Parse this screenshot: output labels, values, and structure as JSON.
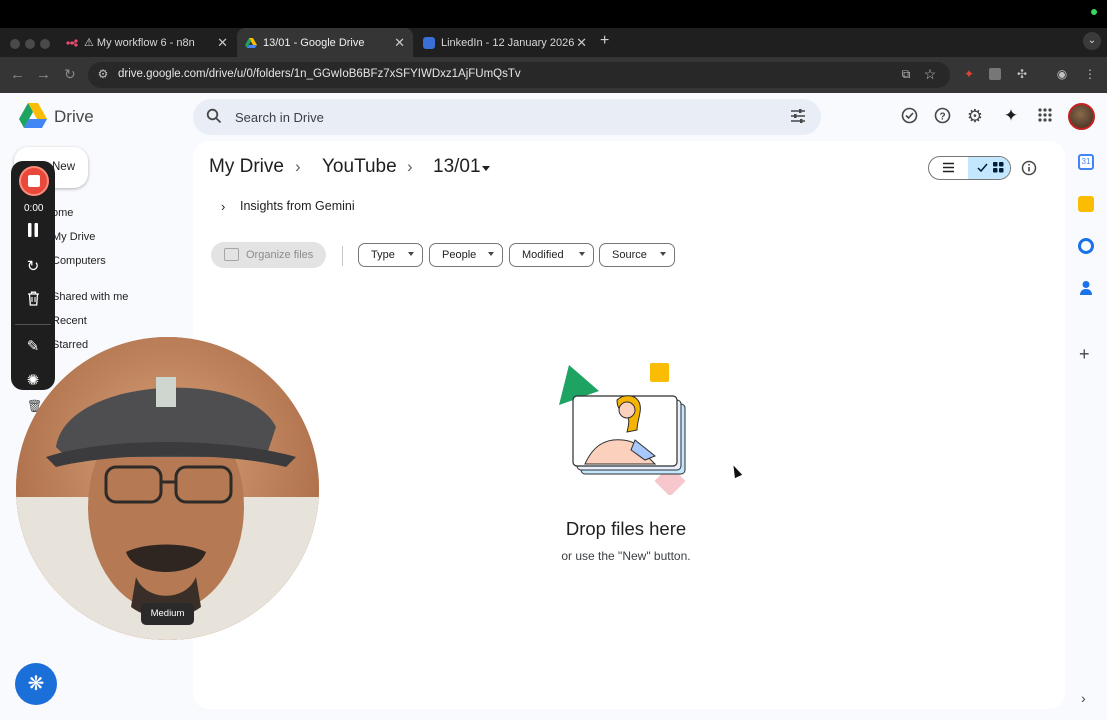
{
  "browser": {
    "tabs": [
      {
        "title": "⚠ My workflow 6 - n8n",
        "active": false
      },
      {
        "title": "13/01 - Google Drive",
        "active": true
      },
      {
        "title": "LinkedIn - 12 January 2026",
        "active": false
      }
    ],
    "new_tab_symbol": "+",
    "close_symbol": "✕",
    "url": "drive.google.com/drive/u/0/folders/1n_GGwIoB6BFz7xSFYIWDxz1AjFUmQsTv"
  },
  "drive": {
    "app_name": "Drive",
    "search_placeholder": "Search in Drive",
    "new_label": "New",
    "nav": [
      {
        "label": "Home",
        "visible": "ome"
      },
      {
        "label": "My Drive",
        "visible": "My Drive"
      },
      {
        "label": "Computers",
        "visible": "Computers"
      },
      {
        "label": "Shared with me",
        "visible": "Shared with me"
      },
      {
        "label": "Recent",
        "visible": "Recent"
      },
      {
        "label": "Starred",
        "visible": "Starred"
      }
    ],
    "breadcrumb": [
      "My Drive",
      "YouTube",
      "13/01"
    ],
    "gemini_label": "Insights from Gemini",
    "organize_label": "Organize files",
    "filters": [
      "Type",
      "People",
      "Modified",
      "Source"
    ],
    "empty_title": "Drop files here",
    "empty_subtitle": "or use the \"New\" button."
  },
  "recorder": {
    "time": "0:00",
    "webcam_tooltip": "Medium"
  },
  "colors": {
    "drive_bg": "#f8fafd",
    "search_bg": "#e9eef6",
    "accent_blue": "#0b57d0",
    "toggle_selected": "#c2e7ff",
    "record_red": "#e8493a"
  },
  "icons": [
    "search-icon",
    "tune-icon",
    "ready-offline-icon",
    "help-icon",
    "settings-icon",
    "gemini-icon",
    "apps-icon",
    "list-view-icon",
    "grid-view-icon",
    "info-icon",
    "calendar-icon",
    "keep-icon",
    "tasks-icon",
    "contacts-icon",
    "plus-icon",
    "chevron-right-icon"
  ]
}
